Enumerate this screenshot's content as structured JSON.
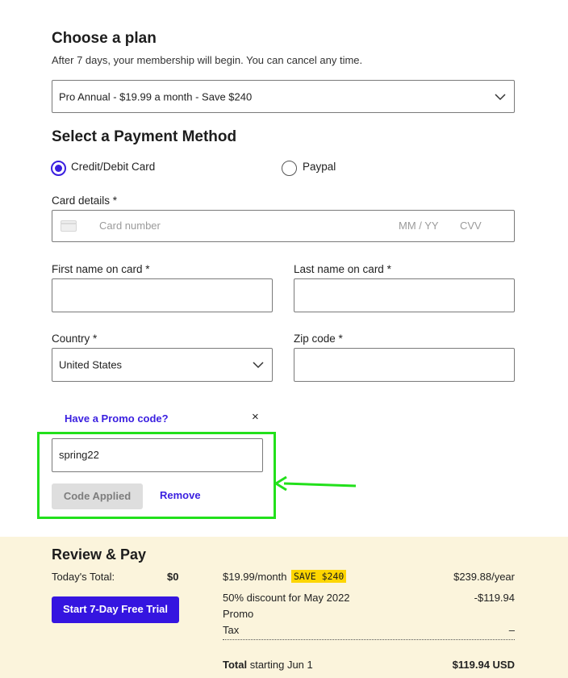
{
  "plan": {
    "heading": "Choose a plan",
    "subtitle": "After 7 days, your membership will begin. You can cancel any time.",
    "selected": "Pro Annual - $19.99 a month - Save $240"
  },
  "payment": {
    "heading": "Select a Payment Method",
    "options": [
      {
        "label": "Credit/Debit Card",
        "selected": true
      },
      {
        "label": "Paypal",
        "selected": false
      }
    ],
    "card_label": "Card details *",
    "card_number_placeholder": "Card number",
    "expiry_placeholder": "MM / YY",
    "cvv_placeholder": "CVV",
    "first_name_label": "First name on card *",
    "last_name_label": "Last name on card *",
    "country_label": "Country *",
    "country_value": "United States",
    "zip_label": "Zip code *"
  },
  "promo": {
    "link": "Have a Promo code?",
    "close": "×",
    "code": "spring22",
    "applied_label": "Code Applied",
    "remove_label": "Remove"
  },
  "review": {
    "heading": "Review & Pay",
    "todays_total_label": "Today's Total:",
    "todays_total_value": "$0",
    "cta_label": "Start 7-Day Free Trial",
    "line1_price": "$19.99/month",
    "line1_tag": "SAVE $240",
    "line1_value": "$239.88/year",
    "line2_label": "50% discount for May 2022",
    "line2_value": "-$119.94",
    "line3_label": "Promo",
    "line4_label": "Tax",
    "line4_value": "–",
    "total_bold": "Total",
    "total_rest": " starting Jun 1",
    "total_value": "$119.94 USD"
  },
  "colors": {
    "accent": "#3a1fe0",
    "highlight": "#22e01b",
    "review_bg": "#fbf4dc",
    "save_tag": "#fdd500"
  },
  "icons": {
    "card": "credit-card-icon",
    "chevron": "chevron-down-icon",
    "close": "close-icon",
    "arrow": "arrow-left-annotation"
  }
}
